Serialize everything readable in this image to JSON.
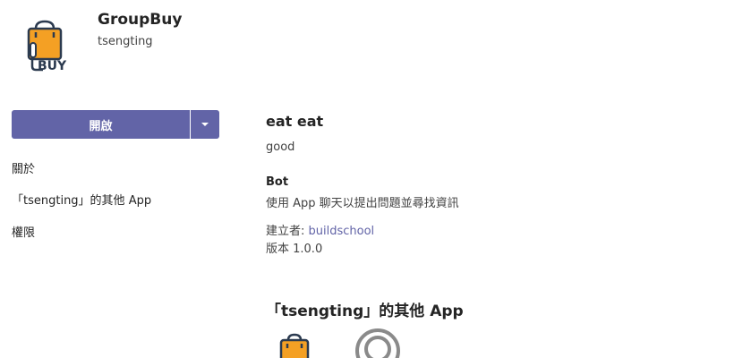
{
  "app": {
    "name": "GroupBuy",
    "developer": "tsengting",
    "logo_text": "BUY",
    "icon": "shopping-bag-icon"
  },
  "sidebar": {
    "open_label": "開啟",
    "items": [
      {
        "label": "關於"
      },
      {
        "label": "「tsengting」的其他 App"
      },
      {
        "label": "權限"
      }
    ]
  },
  "main": {
    "title": "eat eat",
    "description": "good",
    "capability_title": "Bot",
    "capability_desc": "使用 App 聊天以提出問題並尋找資訊",
    "creator_label": "建立者: ",
    "creator_name": "buildschool",
    "version": "版本 1.0.0"
  },
  "more_apps": {
    "title": "「tsengting」的其他 App",
    "apps": [
      {
        "icon": "shopping-bag-icon"
      },
      {
        "icon": "ring-logo-icon"
      }
    ]
  },
  "colors": {
    "accent": "#6264a7",
    "bag_orange": "#f4a024",
    "dark": "#2b3a4f"
  }
}
